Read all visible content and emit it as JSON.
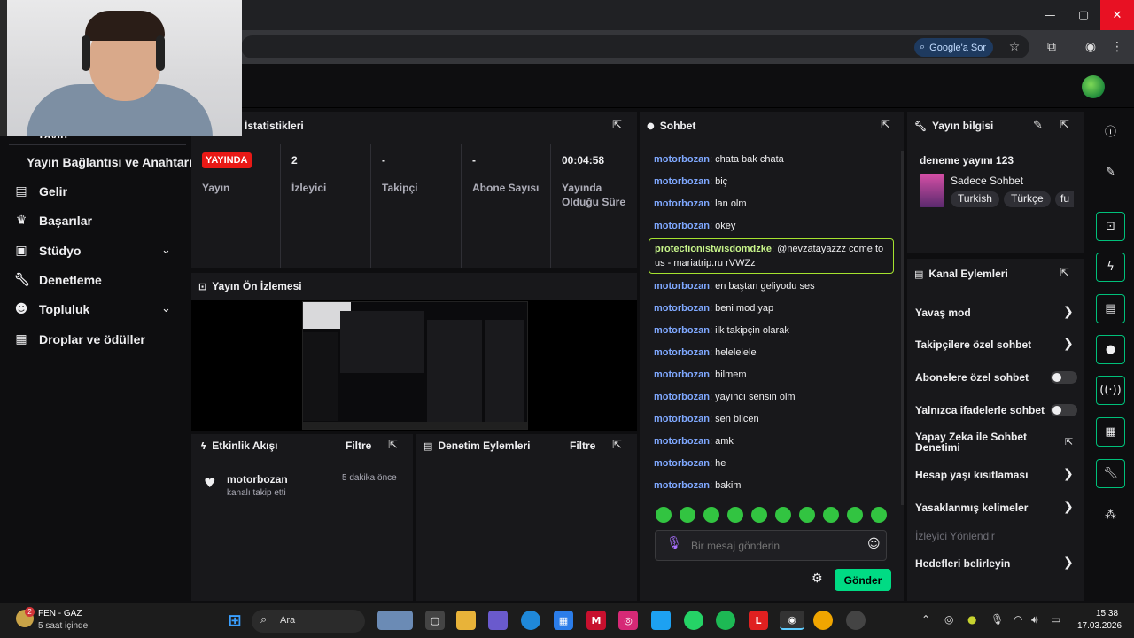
{
  "browser": {
    "ask_google": "Google'a Sor",
    "window_buttons": {
      "minimize": "—",
      "maximize": "▢",
      "close": "✕"
    }
  },
  "nav": {
    "partial_item": "Yayın",
    "items": [
      {
        "label": "Yayın Bağlantısı ve Anahtarı",
        "icon": "none"
      },
      {
        "label": "Gelir",
        "icon": "revenue-icon"
      },
      {
        "label": "Başarılar",
        "icon": "trophy-icon"
      },
      {
        "label": "Stüdyo",
        "icon": "studio-icon",
        "expandable": true
      },
      {
        "label": "Denetleme",
        "icon": "wrench-icon"
      },
      {
        "label": "Topluluk",
        "icon": "community-icon",
        "expandable": true
      },
      {
        "label": "Droplar ve ödüller",
        "icon": "drops-icon"
      }
    ]
  },
  "stats": {
    "title": "İstatistikleri",
    "live_badge": "YAYINDA",
    "columns": [
      {
        "value": "",
        "label": "Yayın"
      },
      {
        "value": "2",
        "label": "İzleyici"
      },
      {
        "value": "-",
        "label": "Takipçi"
      },
      {
        "value": "-",
        "label": "Abone Sayısı"
      },
      {
        "value": "00:04:58",
        "label": "Yayında Olduğu Süre"
      }
    ]
  },
  "preview": {
    "title": "Yayın Ön İzlemesi"
  },
  "activity": {
    "title": "Etkinlik Akışı",
    "filter": "Filtre",
    "events": [
      {
        "user": "motorbozan",
        "text": "kanalı takip etti",
        "time": "5 dakika önce"
      }
    ]
  },
  "moderation": {
    "title": "Denetim Eylemleri",
    "filter": "Filtre"
  },
  "chat": {
    "title": "Sohbet",
    "messages": [
      {
        "user": "motorbozan",
        "text": "chata bak chata"
      },
      {
        "user": "motorbozan",
        "text": "biç"
      },
      {
        "user": "motorbozan",
        "text": "lan olm"
      },
      {
        "user": "motorbozan",
        "text": "okey"
      },
      {
        "user": "protectionistwisdomdzke",
        "text": "@nevzatayazzz come to us - mariatrip.ru rVWZz"
      },
      {
        "user": "motorbozan",
        "text": "en baştan geliyodu ses"
      },
      {
        "user": "motorbozan",
        "text": "beni mod yap"
      },
      {
        "user": "motorbozan",
        "text": "ilk takipçin olarak"
      },
      {
        "user": "motorbozan",
        "text": "helelelele"
      },
      {
        "user": "motorbozan",
        "text": "bilmem"
      },
      {
        "user": "motorbozan",
        "text": "yayıncı sensin olm"
      },
      {
        "user": "motorbozan",
        "text": "sen bilcen"
      },
      {
        "user": "motorbozan",
        "text": "amk"
      },
      {
        "user": "motorbozan",
        "text": "he"
      },
      {
        "user": "motorbozan",
        "text": "bakim"
      }
    ],
    "input_placeholder": "Bir mesaj gönderin",
    "send_label": "Gönder",
    "user_color": "#7fa8ff",
    "highlight_color": "#a5e22f"
  },
  "stream_info": {
    "title": "Yayın bilgisi",
    "stream_title": "deneme yayını 123",
    "category": "Sadece Sohbet",
    "tags": [
      "Turkish",
      "Türkçe",
      "fu"
    ]
  },
  "channel_actions": {
    "title": "Kanal Eylemleri",
    "items": [
      {
        "label": "Yavaş mod",
        "control": "chevron"
      },
      {
        "label": "Takipçilere özel sohbet",
        "control": "chevron"
      },
      {
        "label": "Abonelere özel sohbet",
        "control": "toggle"
      },
      {
        "label": "Yalnızca ifadelerle sohbet",
        "control": "toggle"
      },
      {
        "label": "Yapay Zeka ile Sohbet Denetimi",
        "control": "external"
      },
      {
        "label": "Hesap yaşı kısıtlaması",
        "control": "chevron"
      },
      {
        "label": "Yasaklanmış kelimeler",
        "control": "chevron"
      },
      {
        "label": "İzleyici Yönlendir",
        "control": "none",
        "disabled": true
      },
      {
        "label": "Hedefleri belirleyin",
        "control": "chevron"
      }
    ]
  },
  "taskbar": {
    "weather_title": "FEN - GAZ",
    "weather_sub": "5 saat içinde",
    "search_placeholder": "Ara",
    "time": "15:38",
    "date": "17.03.2026",
    "notification_count": "2"
  }
}
